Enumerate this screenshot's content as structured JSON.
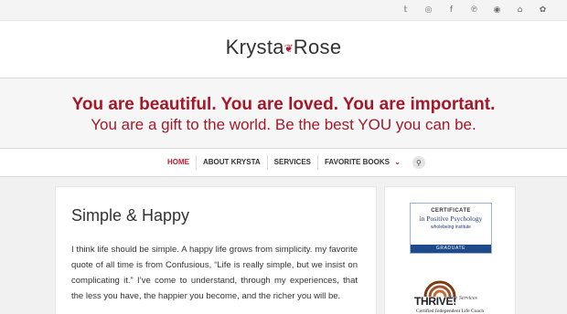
{
  "social_icons": [
    "twitter-icon",
    "instagram-icon",
    "facebook-icon",
    "pinterest-icon",
    "spotify-icon",
    "houzz-icon",
    "bloglovin-icon"
  ],
  "social_glyphs": [
    "𝕥",
    "◎",
    "f",
    "℗",
    "◉",
    "⌂",
    "✿"
  ],
  "logo": {
    "left": "Krysta",
    "right": "Rose",
    "flower": "❦"
  },
  "tagline": {
    "line1": "You are beautiful. You are loved. You are important.",
    "line2": "You are a gift to the world. Be the best YOU you can be.",
    "color": "#a3192a"
  },
  "nav": {
    "items": [
      {
        "label": "HOME",
        "active": true
      },
      {
        "label": "ABOUT KRYSTA",
        "active": false
      },
      {
        "label": "SERVICES",
        "active": false
      },
      {
        "label": "FAVORITE BOOKS",
        "active": false
      }
    ],
    "dropdown_glyph": "⌄",
    "search_glyph": "⚲"
  },
  "post": {
    "title": "Simple & Happy",
    "body": "I think life should be simple. A happy life grows from simplicity.  my favorite quote of all time is from Confusious, “Life is really simple, but we insist on complicating it.” I’ve come to understand, through my experiences, that the less you have, the happier you become, and the richer you will be."
  },
  "sidebar": {
    "certificate": {
      "heading": "CERTIFICATE",
      "title": "in Positive Psychology",
      "org": "wholebeing institute",
      "footer": "GRADUATE"
    },
    "thrive": {
      "word": "THRIVE!",
      "sub": "Life Services",
      "cert": "Certified Independent Life Coach"
    }
  },
  "accent": "#b71c2c"
}
